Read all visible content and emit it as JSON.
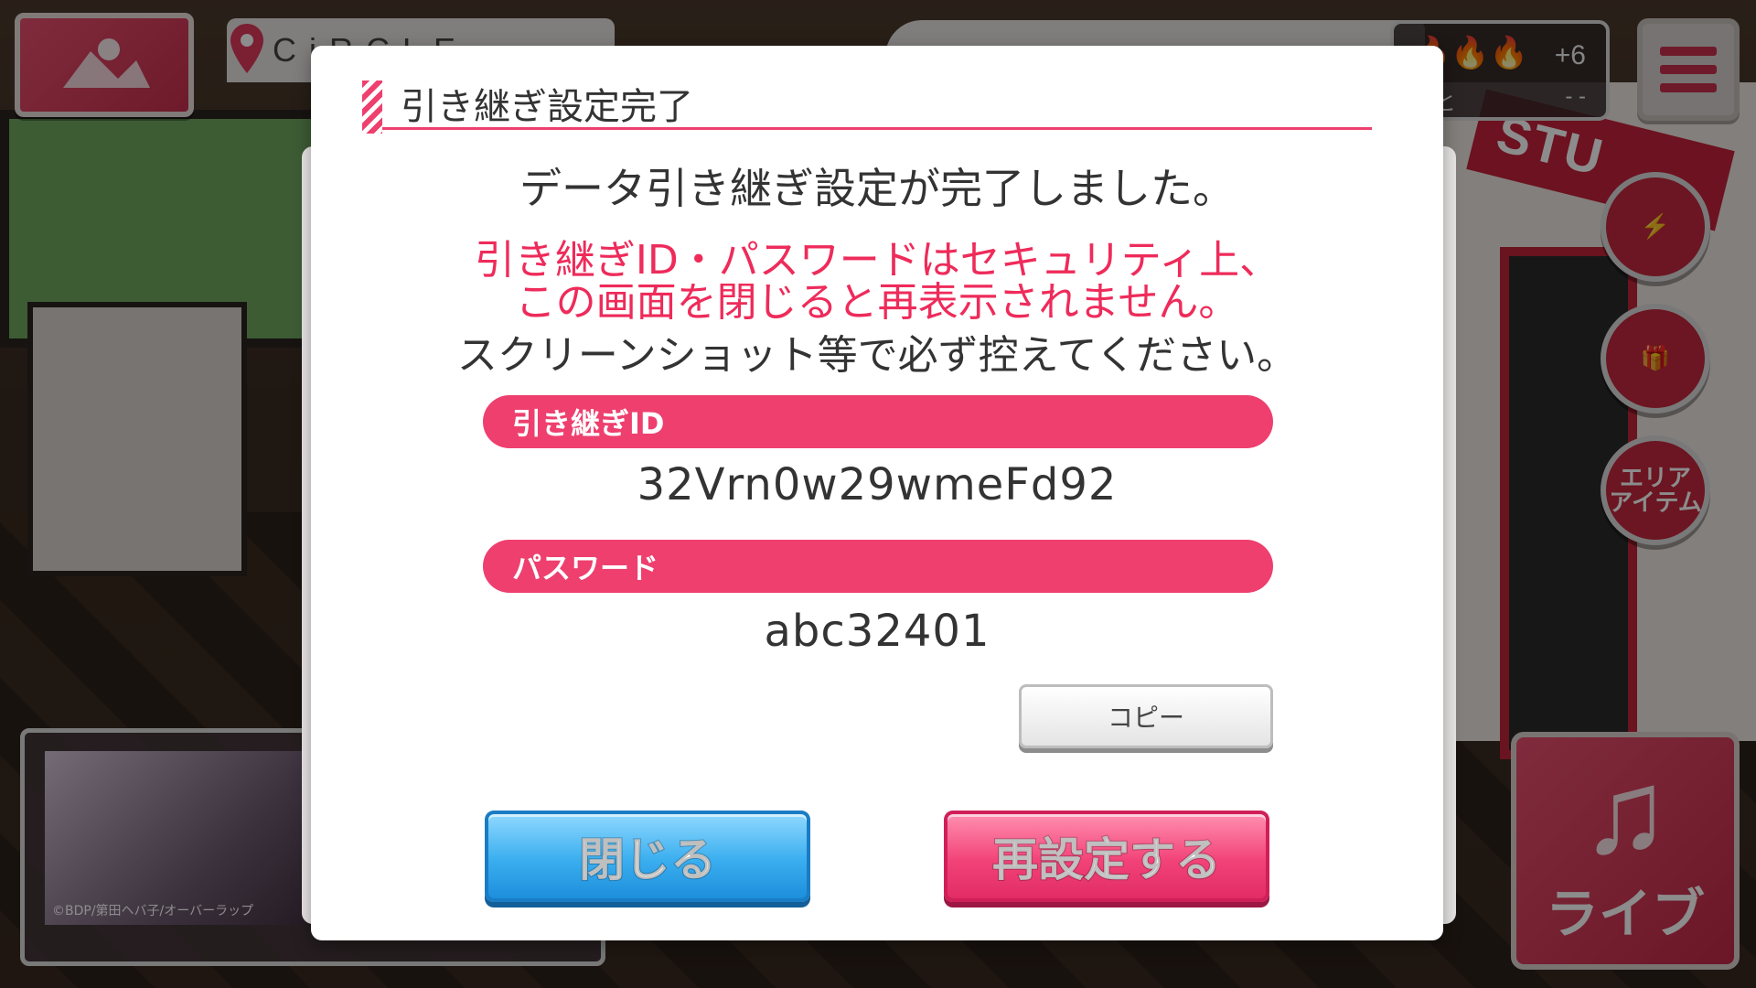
{
  "background": {
    "location_name": "CiRCLE",
    "stamina_plus": "+6",
    "stamina_remain_label": "あと",
    "stamina_remain_value": "- -",
    "right_buttons": {
      "area_item": "エリア\nアイテム"
    },
    "live_button_label": "ライブ",
    "studio_sign": "STU",
    "banner_copyright": "©BDP/第田ヘバ子/オーバーラップ"
  },
  "dialog": {
    "title": "引き継ぎ設定完了",
    "message_main": "データ引き継ぎ設定が完了しました。",
    "message_warning_line1": "引き継ぎID・パスワードはセキュリティ上、",
    "message_warning_line2": "この画面を閉じると再表示されません。",
    "message_note": "スクリーンショット等で必ず控えてください。",
    "id_label": "引き継ぎID",
    "id_value": "32Vrn0w29wmeFd92",
    "password_label": "パスワード",
    "password_value": "abc32401",
    "copy_button": "コピー",
    "close_button": "閉じる",
    "reset_button": "再設定する"
  },
  "colors": {
    "accent_pink": "#ee3f6e",
    "warning_text": "#ee2b5a",
    "close_blue": "#3aaeef"
  }
}
